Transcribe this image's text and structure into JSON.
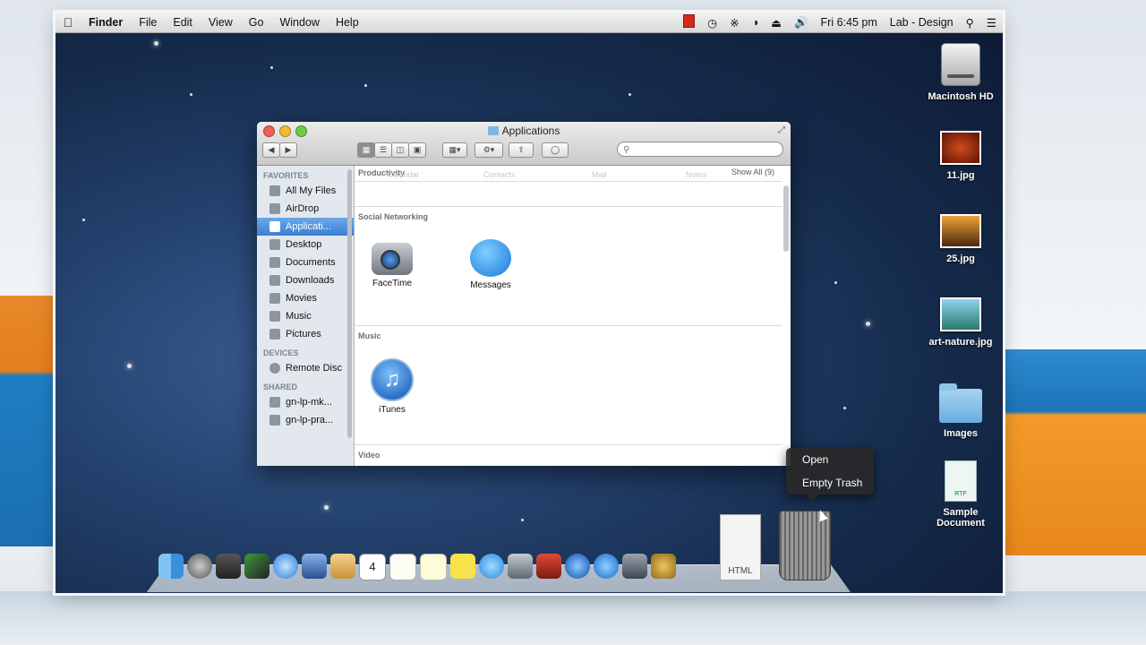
{
  "menubar": {
    "apple": "",
    "items": [
      "Finder",
      "File",
      "Edit",
      "View",
      "Go",
      "Window",
      "Help"
    ],
    "clock": "Fri 6:45 pm",
    "user": "Lab - Design"
  },
  "desktop_icons": [
    "Macintosh HD",
    "11.jpg",
    "25.jpg",
    "art-nature.jpg",
    "Images",
    "Sample Document"
  ],
  "desktop_extras": {
    "rtf_label": "RTF"
  },
  "finder": {
    "title": "Applications",
    "search_placeholder": "",
    "sidebar": {
      "favorites_header": "FAVORITES",
      "favorites": [
        "All My Files",
        "AirDrop",
        "Applicati...",
        "Desktop",
        "Documents",
        "Downloads",
        "Movies",
        "Music",
        "Pictures"
      ],
      "devices_header": "DEVICES",
      "devices": [
        "Remote Disc"
      ],
      "shared_header": "SHARED",
      "shared": [
        "gn-lp-mk...",
        "gn-lp-pra..."
      ]
    },
    "sections": {
      "productivity": "Productivity",
      "social": "Social Networking",
      "music": "Music",
      "video": "Video"
    },
    "show_all": "Show All (9)",
    "ghost_labels": [
      "Calendar",
      "Contacts",
      "Mail",
      "Notes"
    ],
    "apps": {
      "facetime": "FaceTime",
      "messages": "Messages",
      "itunes": "iTunes"
    }
  },
  "context_menu": {
    "open": "Open",
    "empty_trash": "Empty Trash"
  },
  "dock": {
    "html_label": "HTML",
    "calendar_day": "4"
  },
  "colors": {
    "selection": "#3b7fd4",
    "desktop": "#1b345c"
  }
}
